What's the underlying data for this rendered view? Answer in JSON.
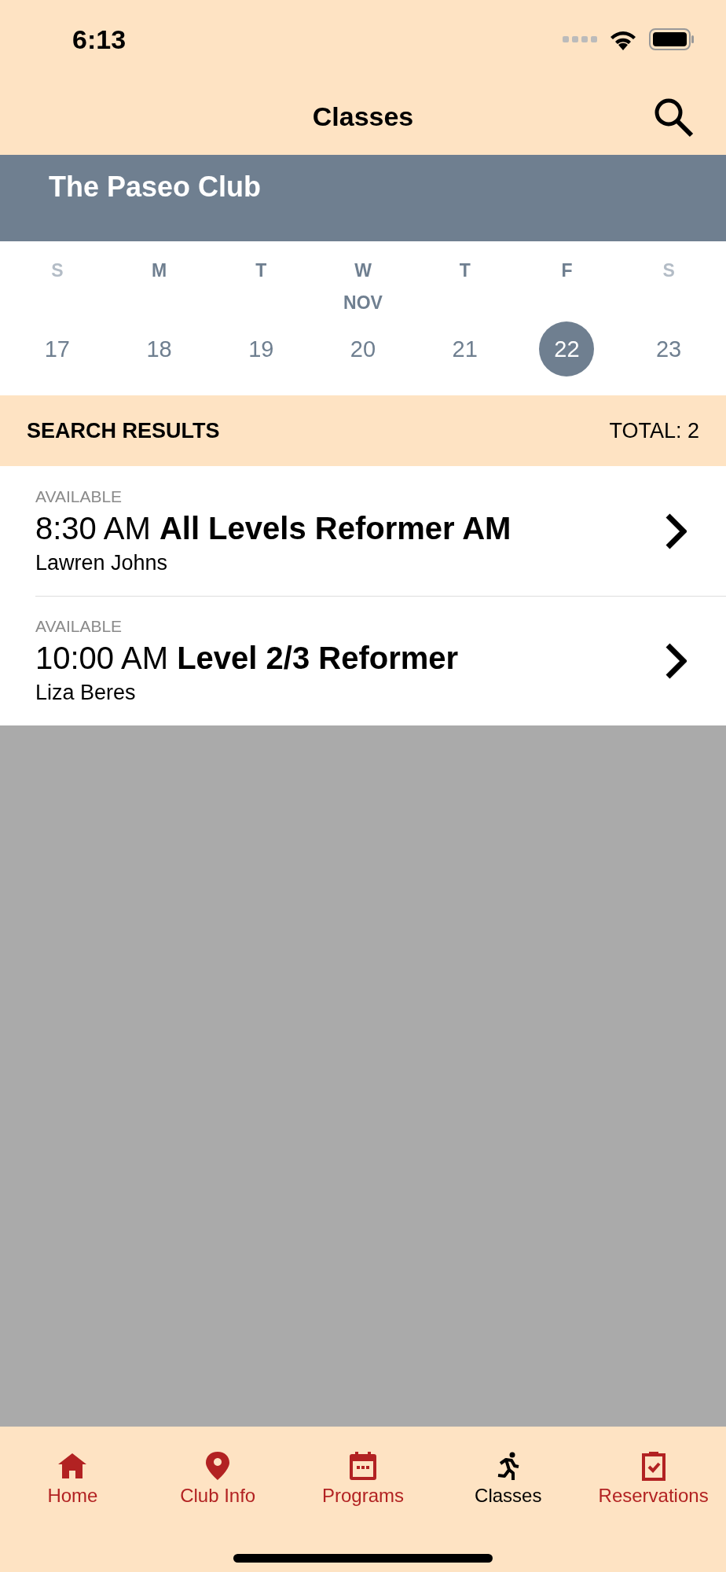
{
  "status_bar": {
    "time": "6:13"
  },
  "nav": {
    "title": "Classes"
  },
  "club": {
    "name": "The Paseo Club"
  },
  "calendar": {
    "month": "NOV",
    "weekdays": [
      {
        "label": "S",
        "weekend": true
      },
      {
        "label": "M",
        "weekend": false
      },
      {
        "label": "T",
        "weekend": false
      },
      {
        "label": "W",
        "weekend": false
      },
      {
        "label": "T",
        "weekend": false
      },
      {
        "label": "F",
        "weekend": false
      },
      {
        "label": "S",
        "weekend": true
      }
    ],
    "days": [
      {
        "label": "17",
        "selected": false
      },
      {
        "label": "18",
        "selected": false
      },
      {
        "label": "19",
        "selected": false
      },
      {
        "label": "20",
        "selected": false
      },
      {
        "label": "21",
        "selected": false
      },
      {
        "label": "22",
        "selected": true
      },
      {
        "label": "23",
        "selected": false
      }
    ]
  },
  "results": {
    "heading": "SEARCH RESULTS",
    "total": "TOTAL: 2",
    "items": [
      {
        "status": "AVAILABLE",
        "title": "8:30 AM **All Levels Reformer AM**",
        "instructor": "Lawren Johns"
      },
      {
        "status": "AVAILABLE",
        "title": "10:00 AM **Level 2/3 Reformer**",
        "instructor": "Liza Beres"
      }
    ]
  },
  "tab_bar": [
    {
      "kind": "home",
      "label": "Home",
      "selected": false
    },
    {
      "kind": "pin",
      "label": "Club Info",
      "selected": false
    },
    {
      "kind": "calendar",
      "label": "Programs",
      "selected": false
    },
    {
      "kind": "runner",
      "label": "Classes",
      "selected": true
    },
    {
      "kind": "clipboard",
      "label": "Reservations",
      "selected": false
    }
  ]
}
